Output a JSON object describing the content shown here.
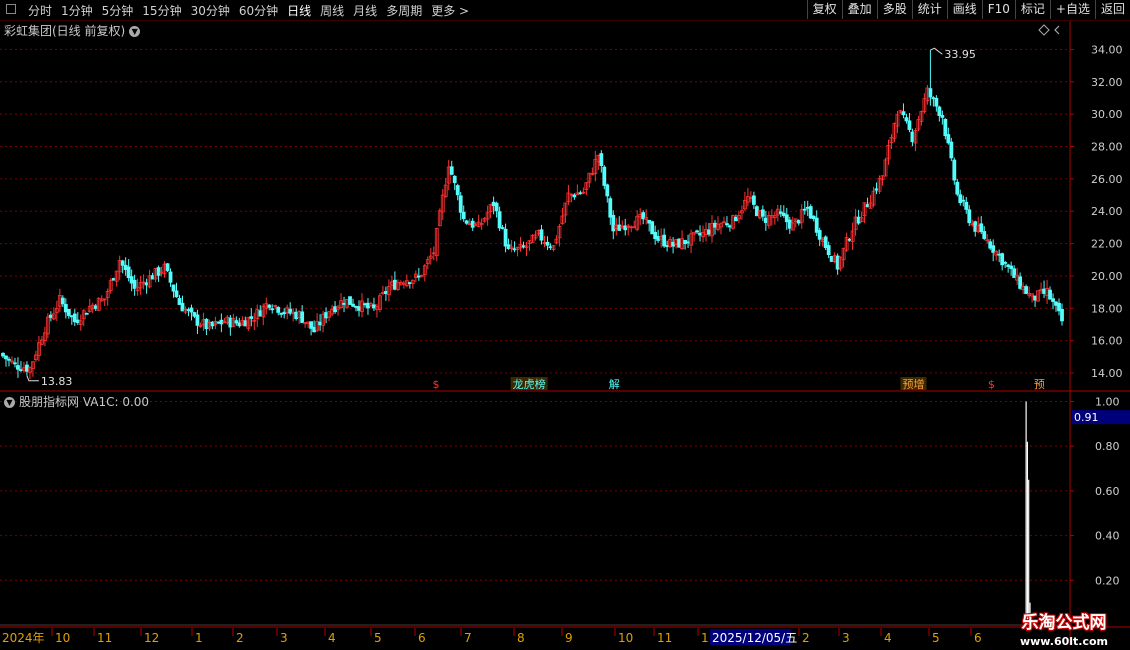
{
  "toolbar": {
    "periods": [
      "分时",
      "1分钟",
      "5分钟",
      "15分钟",
      "30分钟",
      "60分钟",
      "日线",
      "周线",
      "月线",
      "多周期",
      "更多 >"
    ],
    "active_period": "日线",
    "actions": [
      "复权",
      "叠加",
      "多股",
      "统计",
      "画线",
      "F10",
      "标记",
      "+自选",
      "返回"
    ]
  },
  "header": {
    "title": "彩虹集团(日线 前复权)",
    "icon": "chevron-down-icon"
  },
  "sub_header": {
    "label": "股朋指标网  VA1C: 0.00",
    "icon": "chevron-down-icon"
  },
  "colors": {
    "up": "#ff3232",
    "down": "#54fcfc",
    "grid": "#7a0000",
    "axis": "#b00000",
    "indicator": "#ffffff",
    "highlight_bg": "#00007a"
  },
  "chart_data": [
    {
      "type": "candlestick",
      "ylim": [
        13.2,
        35.2
      ],
      "yticks": [
        "34.00",
        "32.00",
        "30.00",
        "28.00",
        "26.00",
        "24.00",
        "22.00",
        "20.00",
        "18.00",
        "16.00",
        "14.00"
      ],
      "annotations": [
        {
          "label": "33.95",
          "kind": "high"
        },
        {
          "label": "13.83",
          "kind": "low"
        }
      ],
      "event_markers": [
        "$",
        "龙虎榜",
        "解",
        "预增",
        "$",
        "预"
      ],
      "anchor_closes": [
        15.2,
        14.5,
        14.3,
        16.8,
        18.5,
        17.2,
        18.1,
        18.6,
        21.0,
        19.2,
        19.9,
        20.5,
        18.3,
        17.3,
        16.8,
        17.2,
        17.1,
        17.5,
        18.4,
        17.8,
        17.6,
        16.6,
        17.9,
        18.5,
        18.2,
        17.9,
        19.3,
        19.8,
        19.9,
        21.5,
        27.0,
        23.5,
        23.0,
        24.5,
        21.5,
        21.7,
        22.5,
        21.8,
        25.0,
        25.2,
        27.5,
        22.8,
        23.3,
        23.5,
        22.3,
        21.9,
        22.2,
        22.6,
        23.2,
        23.4,
        24.8,
        23.5,
        23.8,
        23.1,
        24.2,
        22.2,
        20.6,
        23.0,
        24.5,
        26.2,
        30.3,
        28.6,
        31.4,
        29.9,
        25.0,
        23.2,
        22.2,
        21.0,
        19.7,
        18.6,
        19.0,
        17.2
      ],
      "series_low": 13.83,
      "series_high": 33.95
    },
    {
      "type": "line",
      "name": "VA1C",
      "ylim": [
        0,
        1.02
      ],
      "yticks": [
        "1.00",
        "0.80",
        "0.60",
        "0.40",
        "0.20"
      ],
      "current_value": "0.91",
      "spike_values": [
        1.0,
        0.82,
        0.65,
        0.1
      ]
    }
  ],
  "x_axis": {
    "labels": [
      "2024年",
      "10",
      "11",
      "12",
      "1",
      "2",
      "3",
      "4",
      "5",
      "6",
      "7",
      "8",
      "9",
      "10",
      "11",
      "1",
      "2025/12/05/五",
      "2",
      "3",
      "4",
      "5",
      "6"
    ]
  },
  "watermark": {
    "line1": "乐淘公式网",
    "line2": "www.60lt.com"
  }
}
